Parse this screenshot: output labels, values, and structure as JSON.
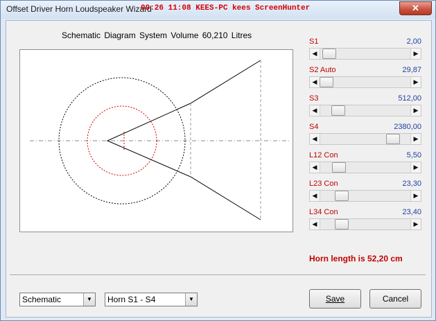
{
  "window": {
    "title": "Offset Driver Horn Loudspeaker Wizard",
    "overlay": "09:26 11:08 KEES-PC kees ScreenHunter",
    "close_label": "✕"
  },
  "diagram": {
    "title": "Schematic Diagram   System Volume 60,210 Litres"
  },
  "sliders": [
    {
      "label": "S1",
      "value": "2,00",
      "position": 0.04
    },
    {
      "label": "S2 Auto",
      "value": "29,87",
      "position": 0.0
    },
    {
      "label": "S3",
      "value": "512,00",
      "position": 0.15
    },
    {
      "label": "S4",
      "value": "2380,00",
      "position": 0.86
    },
    {
      "label": "L12 Con",
      "value": "5,50",
      "position": 0.16
    },
    {
      "label": "L23 Con",
      "value": "23,30",
      "position": 0.2
    },
    {
      "label": "L34 Con",
      "value": "23,40",
      "position": 0.2
    }
  ],
  "horn_length": "Horn length is 52,20 cm",
  "footer": {
    "view_select": "Schematic",
    "horn_select": "Horn S1 - S4",
    "save_label": "Save",
    "cancel_label": "Cancel"
  },
  "icons": {
    "left_arrow": "◀",
    "right_arrow": "▶",
    "dropdown": "▼"
  }
}
